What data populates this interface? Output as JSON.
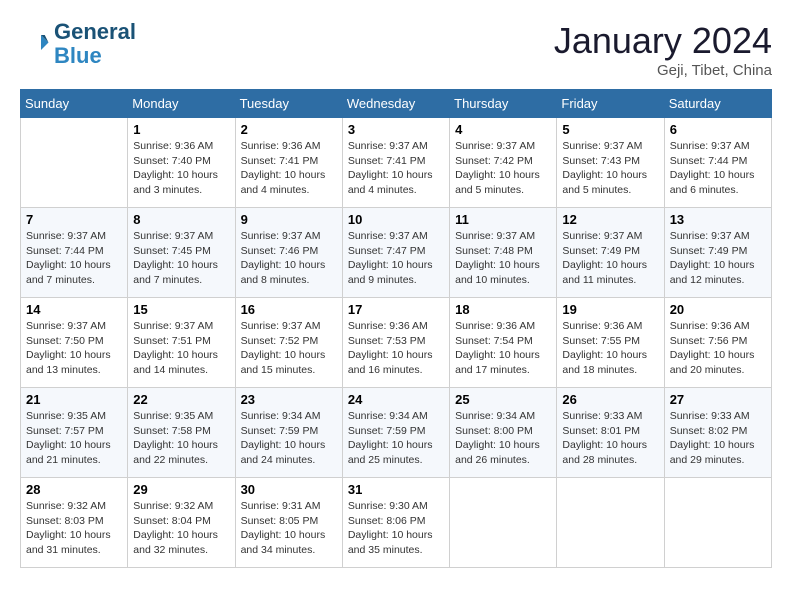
{
  "header": {
    "logo_line1": "General",
    "logo_line2": "Blue",
    "month": "January 2024",
    "location": "Geji, Tibet, China"
  },
  "days_of_week": [
    "Sunday",
    "Monday",
    "Tuesday",
    "Wednesday",
    "Thursday",
    "Friday",
    "Saturday"
  ],
  "weeks": [
    [
      {
        "day": "",
        "info": ""
      },
      {
        "day": "1",
        "info": "Sunrise: 9:36 AM\nSunset: 7:40 PM\nDaylight: 10 hours\nand 3 minutes."
      },
      {
        "day": "2",
        "info": "Sunrise: 9:36 AM\nSunset: 7:41 PM\nDaylight: 10 hours\nand 4 minutes."
      },
      {
        "day": "3",
        "info": "Sunrise: 9:37 AM\nSunset: 7:41 PM\nDaylight: 10 hours\nand 4 minutes."
      },
      {
        "day": "4",
        "info": "Sunrise: 9:37 AM\nSunset: 7:42 PM\nDaylight: 10 hours\nand 5 minutes."
      },
      {
        "day": "5",
        "info": "Sunrise: 9:37 AM\nSunset: 7:43 PM\nDaylight: 10 hours\nand 5 minutes."
      },
      {
        "day": "6",
        "info": "Sunrise: 9:37 AM\nSunset: 7:44 PM\nDaylight: 10 hours\nand 6 minutes."
      }
    ],
    [
      {
        "day": "7",
        "info": "Sunrise: 9:37 AM\nSunset: 7:44 PM\nDaylight: 10 hours\nand 7 minutes."
      },
      {
        "day": "8",
        "info": "Sunrise: 9:37 AM\nSunset: 7:45 PM\nDaylight: 10 hours\nand 7 minutes."
      },
      {
        "day": "9",
        "info": "Sunrise: 9:37 AM\nSunset: 7:46 PM\nDaylight: 10 hours\nand 8 minutes."
      },
      {
        "day": "10",
        "info": "Sunrise: 9:37 AM\nSunset: 7:47 PM\nDaylight: 10 hours\nand 9 minutes."
      },
      {
        "day": "11",
        "info": "Sunrise: 9:37 AM\nSunset: 7:48 PM\nDaylight: 10 hours\nand 10 minutes."
      },
      {
        "day": "12",
        "info": "Sunrise: 9:37 AM\nSunset: 7:49 PM\nDaylight: 10 hours\nand 11 minutes."
      },
      {
        "day": "13",
        "info": "Sunrise: 9:37 AM\nSunset: 7:49 PM\nDaylight: 10 hours\nand 12 minutes."
      }
    ],
    [
      {
        "day": "14",
        "info": "Sunrise: 9:37 AM\nSunset: 7:50 PM\nDaylight: 10 hours\nand 13 minutes."
      },
      {
        "day": "15",
        "info": "Sunrise: 9:37 AM\nSunset: 7:51 PM\nDaylight: 10 hours\nand 14 minutes."
      },
      {
        "day": "16",
        "info": "Sunrise: 9:37 AM\nSunset: 7:52 PM\nDaylight: 10 hours\nand 15 minutes."
      },
      {
        "day": "17",
        "info": "Sunrise: 9:36 AM\nSunset: 7:53 PM\nDaylight: 10 hours\nand 16 minutes."
      },
      {
        "day": "18",
        "info": "Sunrise: 9:36 AM\nSunset: 7:54 PM\nDaylight: 10 hours\nand 17 minutes."
      },
      {
        "day": "19",
        "info": "Sunrise: 9:36 AM\nSunset: 7:55 PM\nDaylight: 10 hours\nand 18 minutes."
      },
      {
        "day": "20",
        "info": "Sunrise: 9:36 AM\nSunset: 7:56 PM\nDaylight: 10 hours\nand 20 minutes."
      }
    ],
    [
      {
        "day": "21",
        "info": "Sunrise: 9:35 AM\nSunset: 7:57 PM\nDaylight: 10 hours\nand 21 minutes."
      },
      {
        "day": "22",
        "info": "Sunrise: 9:35 AM\nSunset: 7:58 PM\nDaylight: 10 hours\nand 22 minutes."
      },
      {
        "day": "23",
        "info": "Sunrise: 9:34 AM\nSunset: 7:59 PM\nDaylight: 10 hours\nand 24 minutes."
      },
      {
        "day": "24",
        "info": "Sunrise: 9:34 AM\nSunset: 7:59 PM\nDaylight: 10 hours\nand 25 minutes."
      },
      {
        "day": "25",
        "info": "Sunrise: 9:34 AM\nSunset: 8:00 PM\nDaylight: 10 hours\nand 26 minutes."
      },
      {
        "day": "26",
        "info": "Sunrise: 9:33 AM\nSunset: 8:01 PM\nDaylight: 10 hours\nand 28 minutes."
      },
      {
        "day": "27",
        "info": "Sunrise: 9:33 AM\nSunset: 8:02 PM\nDaylight: 10 hours\nand 29 minutes."
      }
    ],
    [
      {
        "day": "28",
        "info": "Sunrise: 9:32 AM\nSunset: 8:03 PM\nDaylight: 10 hours\nand 31 minutes."
      },
      {
        "day": "29",
        "info": "Sunrise: 9:32 AM\nSunset: 8:04 PM\nDaylight: 10 hours\nand 32 minutes."
      },
      {
        "day": "30",
        "info": "Sunrise: 9:31 AM\nSunset: 8:05 PM\nDaylight: 10 hours\nand 34 minutes."
      },
      {
        "day": "31",
        "info": "Sunrise: 9:30 AM\nSunset: 8:06 PM\nDaylight: 10 hours\nand 35 minutes."
      },
      {
        "day": "",
        "info": ""
      },
      {
        "day": "",
        "info": ""
      },
      {
        "day": "",
        "info": ""
      }
    ]
  ]
}
